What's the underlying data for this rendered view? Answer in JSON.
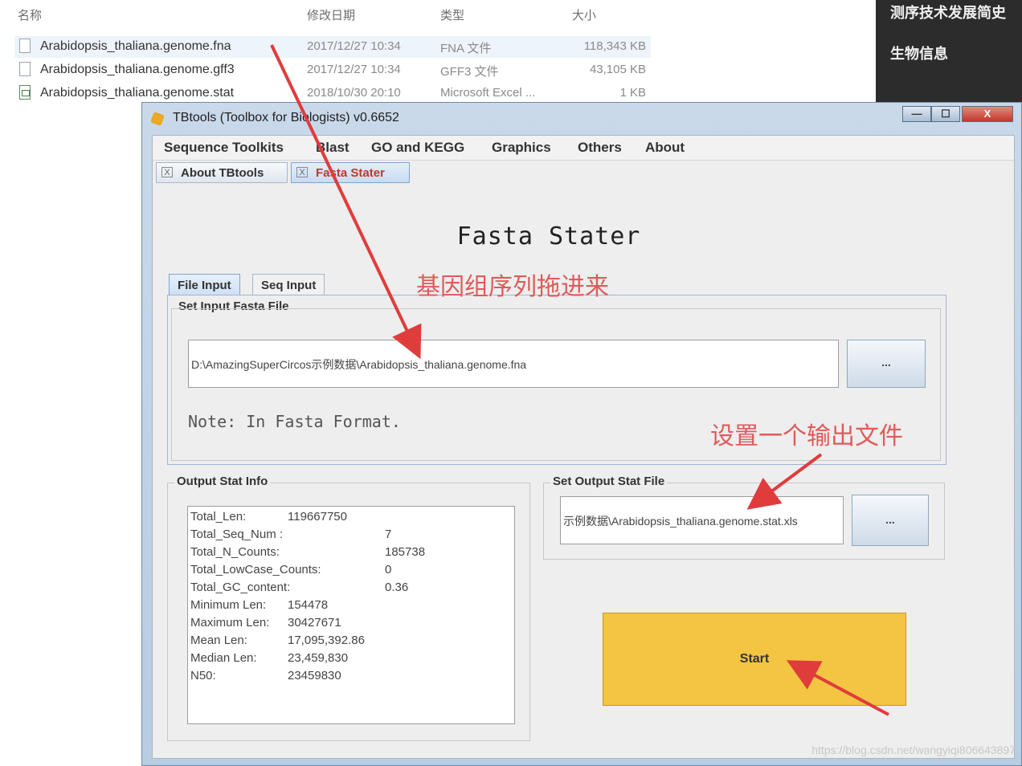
{
  "explorer": {
    "columns": [
      "名称",
      "修改日期",
      "类型",
      "大小"
    ],
    "files": [
      {
        "name": "Arabidopsis_thaliana.genome.fna",
        "date": "2017/12/27 10:34",
        "type": "FNA 文件",
        "size": "118,343 KB"
      },
      {
        "name": "Arabidopsis_thaliana.genome.gff3",
        "date": "2017/12/27 10:34",
        "type": "GFF3 文件",
        "size": "43,105 KB"
      },
      {
        "name": "Arabidopsis_thaliana.genome.stat",
        "date": "2018/10/30 20:10",
        "type": "Microsoft Excel ...",
        "size": "1 KB"
      }
    ]
  },
  "side_panel": {
    "title": "测序技术发展简史",
    "subtitle": "生物信息"
  },
  "window": {
    "title": "TBtools (Toolbox for Biologists) v0.6652",
    "controls": {
      "minimize": "—",
      "maximize": "☐",
      "close": "X"
    },
    "menu": [
      "Sequence Toolkits",
      "Blast",
      "GO and KEGG",
      "Graphics",
      "Others",
      "About"
    ],
    "tabs": [
      {
        "label": "About TBtools",
        "close": "X"
      },
      {
        "label": "Fasta Stater",
        "close": "X"
      }
    ],
    "heading": "Fasta Stater",
    "input_tabs": [
      "File Input",
      "Seq Input"
    ],
    "input_group": {
      "title": "Set Input Fasta File",
      "path": "D:\\AmazingSuperCircos示例数据\\Arabidopsis_thaliana.genome.fna",
      "browse_label": "...",
      "note": "Note: In Fasta Format."
    },
    "output_info": {
      "title": "Output Stat Info",
      "rows": [
        {
          "key": "Total_Len:",
          "value": "119667750"
        },
        {
          "key": "Total_Seq_Num :",
          "value": "7"
        },
        {
          "key": "Total_N_Counts:",
          "value": "185738"
        },
        {
          "key": "Total_LowCase_Counts:",
          "value": "0"
        },
        {
          "key": "Total_GC_content:",
          "value": "0.36"
        },
        {
          "key": "Minimum Len:",
          "value": "154478"
        },
        {
          "key": "Maximum Len:",
          "value": "30427671"
        },
        {
          "key": "Mean Len:",
          "value": "17,095,392.86"
        },
        {
          "key": "Median Len:",
          "value": "23,459,830"
        },
        {
          "key": "N50:",
          "value": "23459830"
        }
      ]
    },
    "output_file": {
      "title": "Set Output Stat File",
      "path": "示例数据\\Arabidopsis_thaliana.genome.stat.xls",
      "browse_label": "..."
    },
    "start_label": "Start"
  },
  "annotations": {
    "drag_in": "基因组序列拖进来",
    "set_output": "设置一个输出文件",
    "arrow_color": "#e03c3c"
  },
  "watermark": "https://blog.csdn.net/wangyiqi806643897"
}
